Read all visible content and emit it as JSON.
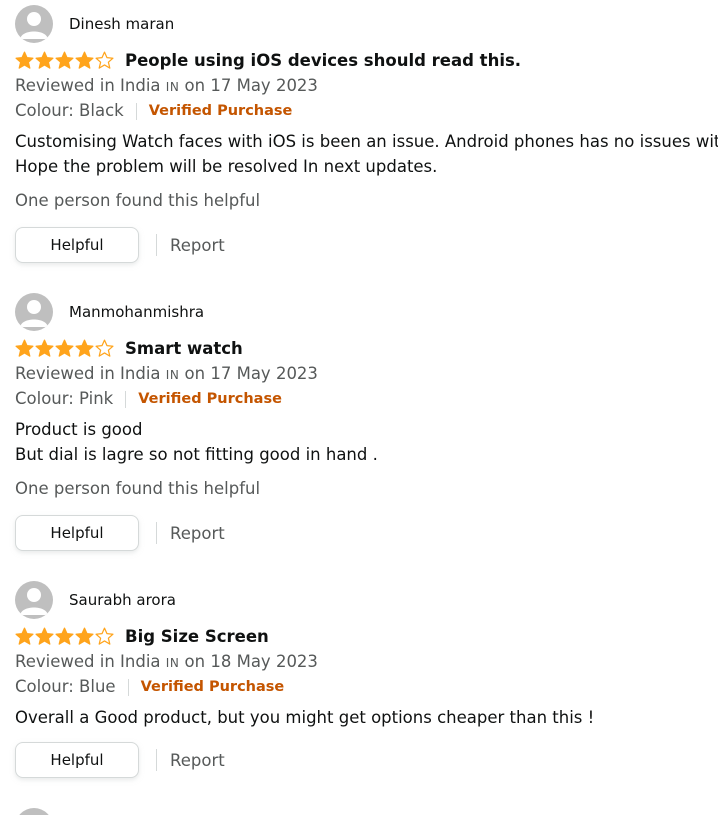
{
  "colors": {
    "star": "#ffa41c",
    "verified": "#c45500",
    "muted": "#565959",
    "text": "#0f1111",
    "avatar": "#bfbfbf"
  },
  "reviews": [
    {
      "profile_name": "Dinesh maran",
      "rating": 4,
      "rating_max": 5,
      "title": "People using iOS devices should read this.",
      "reviewed_prefix": "Reviewed in India",
      "country_code": "IN",
      "reviewed_suffix": "on 17 May 2023",
      "colour": "Colour: Black",
      "verified": "Verified Purchase",
      "body": [
        "Customising Watch faces with iOS is been an issue. Android phones has no issues wit it.",
        "Hope the problem will be resolved In next updates."
      ],
      "helpful_count": "One person found this helpful",
      "helpful_label": "Helpful",
      "report_label": "Report"
    },
    {
      "profile_name": "Manmohanmishra",
      "rating": 4,
      "rating_max": 5,
      "title": "Smart watch",
      "reviewed_prefix": "Reviewed in India",
      "country_code": "IN",
      "reviewed_suffix": "on 17 May 2023",
      "colour": "Colour: Pink",
      "verified": "Verified Purchase",
      "body": [
        "Product is good",
        "But dial is lagre so not fitting good in hand ."
      ],
      "helpful_count": "One person found this helpful",
      "helpful_label": "Helpful",
      "report_label": "Report"
    },
    {
      "profile_name": "Saurabh arora",
      "rating": 4,
      "rating_max": 5,
      "title": "Big Size Screen",
      "reviewed_prefix": "Reviewed in India",
      "country_code": "IN",
      "reviewed_suffix": "on 18 May 2023",
      "colour": "Colour: Blue",
      "verified": "Verified Purchase",
      "body": [
        "Overall a Good product, but you might get options cheaper than this !"
      ],
      "helpful_label": "Helpful",
      "report_label": "Report"
    }
  ]
}
